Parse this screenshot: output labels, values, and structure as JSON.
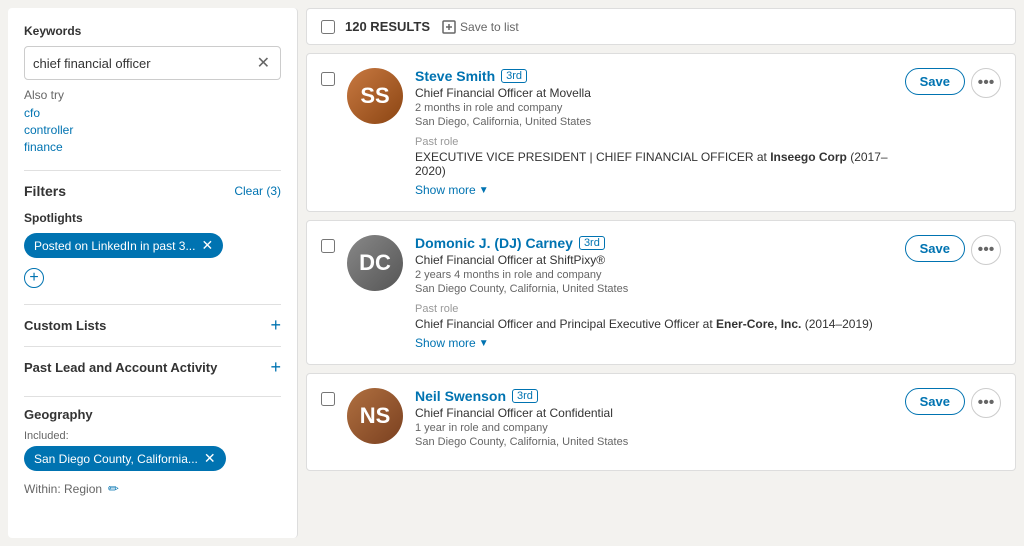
{
  "sidebar": {
    "keywords_label": "Keywords",
    "keyword_value": "chief financial officer",
    "also_try_label": "Also try",
    "also_try_items": [
      "cfo",
      "controller",
      "finance"
    ],
    "filters_title": "Filters",
    "clear_label": "Clear (3)",
    "spotlights_label": "Spotlights",
    "spotlight_tag": "Posted on LinkedIn in past 3...",
    "custom_lists_label": "Custom Lists",
    "past_activity_label": "Past Lead and Account Activity",
    "geography_label": "Geography",
    "included_label": "Included:",
    "geo_tag": "San Diego County, California...",
    "within_label": "Within: Region"
  },
  "results": {
    "count": "120 RESULTS",
    "save_to_list": "Save to list",
    "items": [
      {
        "name": "Steve Smith",
        "degree": "3rd",
        "title": "Chief Financial Officer",
        "company": "Movella",
        "duration": "2 months in role and company",
        "location": "San Diego, California, United States",
        "past_role_label": "Past role",
        "past_role": "EXECUTIVE VICE PRESIDENT | CHIEF FINANCIAL OFFICER at ",
        "past_company": "Inseego Corp",
        "past_years": " (2017–2020)",
        "show_more": "Show more"
      },
      {
        "name": "Domonic J. (DJ) Carney",
        "degree": "3rd",
        "title": "Chief Financial Officer",
        "company": "ShiftPixy®",
        "duration": "2 years 4 months in role and company",
        "location": "San Diego County, California, United States",
        "past_role_label": "Past role",
        "past_role": "Chief Financial Officer and Principal Executive Officer at ",
        "past_company": "Ener-Core, Inc.",
        "past_years": " (2014–2019)",
        "show_more": "Show more"
      },
      {
        "name": "Neil Swenson",
        "degree": "3rd",
        "title": "Chief Financial Officer",
        "company": "Confidential",
        "duration": "1 year in role and company",
        "location": "San Diego County, California, United States",
        "past_role_label": "",
        "past_role": "",
        "past_company": "",
        "past_years": "",
        "show_more": ""
      }
    ],
    "save_btn": "Save",
    "more_btn": "..."
  }
}
